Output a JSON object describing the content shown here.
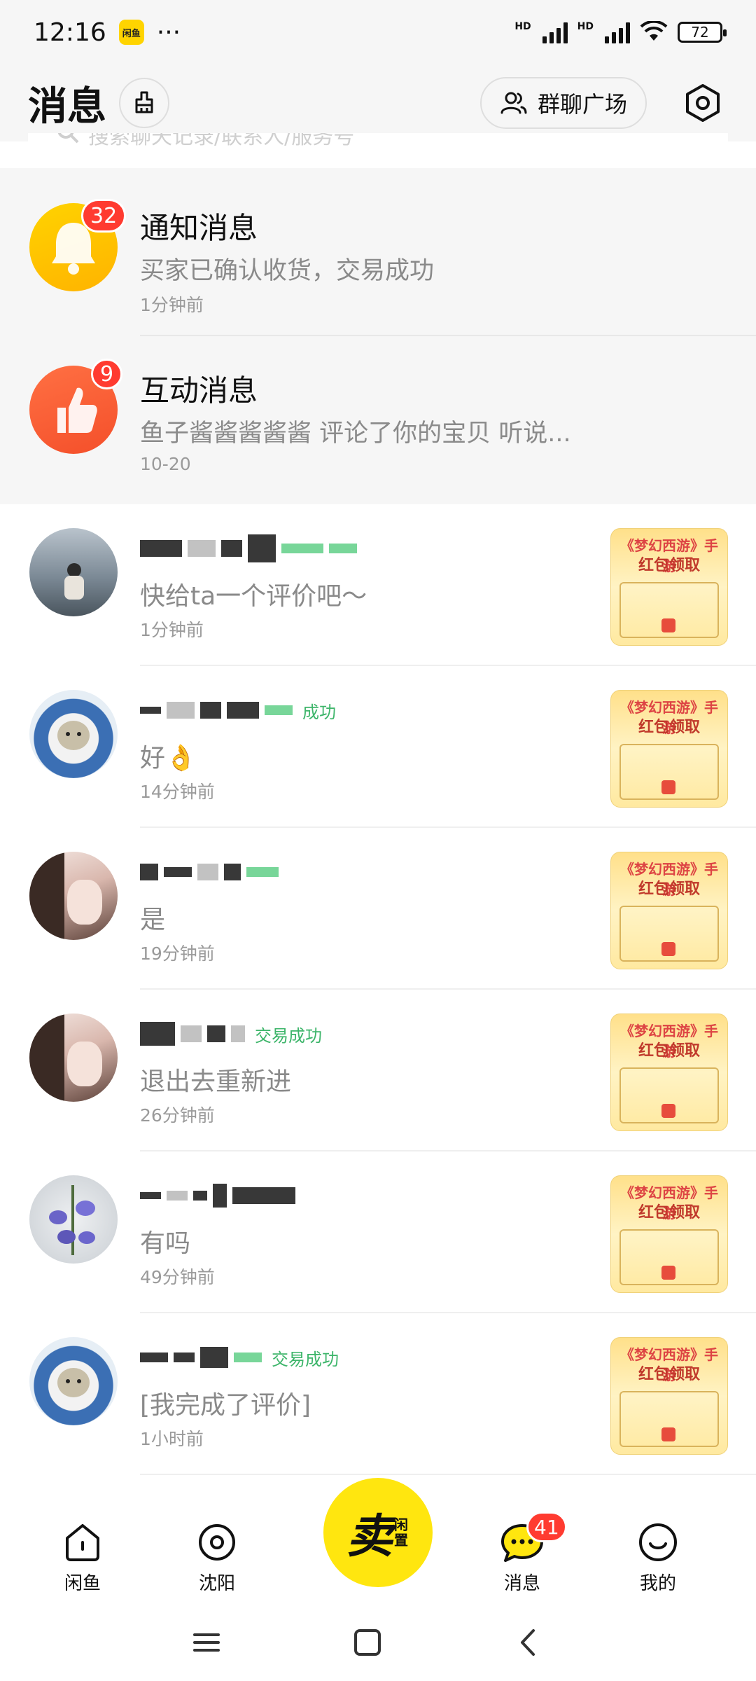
{
  "status_bar": {
    "time": "12:16",
    "more": "···",
    "hd1": "HD",
    "hd2": "HD",
    "battery": "72",
    "app_badge": "闲鱼"
  },
  "header": {
    "title": "消息",
    "group_button_label": "群聊广场"
  },
  "search": {
    "placeholder": "搜索聊天记录/联系人/服务号"
  },
  "system_messages": [
    {
      "title": "通知消息",
      "message": "买家已确认收货，交易成功",
      "time": "1分钟前",
      "badge": "32"
    },
    {
      "title": "互动消息",
      "message": "鱼子酱酱酱酱酱 评论了你的宝贝 听说...",
      "time": "10-20",
      "badge": "9"
    }
  ],
  "chats": [
    {
      "message": "快给ta一个评价吧～",
      "time": "1分钟前",
      "tag": ""
    },
    {
      "message": "好👌",
      "time": "14分钟前",
      "tag": "成功"
    },
    {
      "message": "是",
      "time": "19分钟前",
      "tag": ""
    },
    {
      "message": "退出去重新进",
      "time": "26分钟前",
      "tag": "交易成功"
    },
    {
      "message": "有吗",
      "time": "49分钟前",
      "tag": ""
    },
    {
      "message": "[我完成了评价]",
      "time": "1小时前",
      "tag": "交易成功"
    }
  ],
  "thumbnail": {
    "line1": "《梦幻西游》手游",
    "line2": "红包领取"
  },
  "bottom_nav": {
    "home": "闲鱼",
    "city": "沈阳",
    "sell_main": "卖",
    "sell_sub": "闲置",
    "messages": "消息",
    "messages_badge": "41",
    "mine": "我的"
  },
  "colors": {
    "brand_yellow": "#ffe60f",
    "badge_red": "#ff3b30",
    "notif_yellow": "#ffc400",
    "interact_orange": "#f75a35",
    "text_gray": "#8a8a8a"
  }
}
